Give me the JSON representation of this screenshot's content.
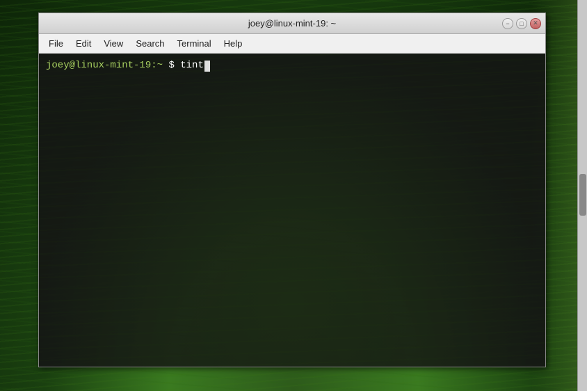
{
  "desktop": {
    "background_desc": "grass nature scene"
  },
  "window": {
    "title": "joey@linux-mint-19: ~",
    "controls": {
      "minimize_label": "−",
      "maximize_label": "□",
      "close_label": "✕"
    }
  },
  "menubar": {
    "items": [
      {
        "id": "file",
        "label": "File"
      },
      {
        "id": "edit",
        "label": "Edit"
      },
      {
        "id": "view",
        "label": "View"
      },
      {
        "id": "search",
        "label": "Search"
      },
      {
        "id": "terminal",
        "label": "Terminal"
      },
      {
        "id": "help",
        "label": "Help"
      }
    ]
  },
  "terminal": {
    "prompt_user": "joey@linux-mint-19:~",
    "prompt_symbol": "$",
    "command": "tint"
  }
}
